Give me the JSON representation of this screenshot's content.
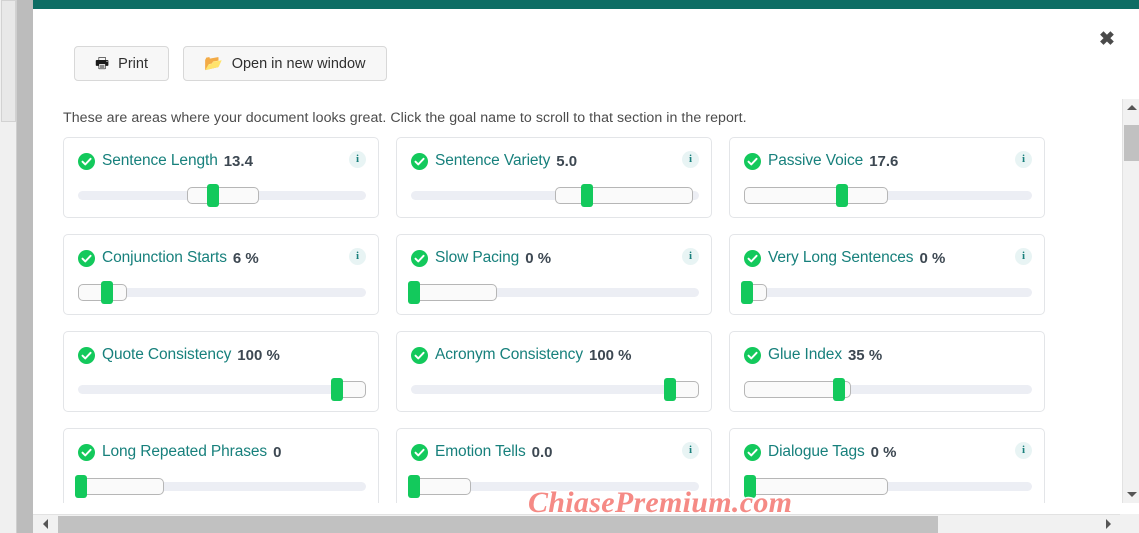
{
  "window": {
    "close_label": "✖",
    "accent_color": "#0e6d64"
  },
  "toolbar": {
    "print_label": "Print",
    "print_icon": "printer-icon",
    "open_label": "Open in new window",
    "open_icon": "folder-open-icon"
  },
  "description": "These are areas where your document looks great. Click the goal name to scroll to that section in the report.",
  "watermark": "ChiasePremium.com",
  "cards": [
    {
      "name": "Sentence Length",
      "value": "13.4",
      "has_info": true,
      "range_left_pct": 38,
      "range_width_pct": 25,
      "thumb_pct": 47
    },
    {
      "name": "Sentence Variety",
      "value": "5.0",
      "has_info": true,
      "range_left_pct": 50,
      "range_width_pct": 48,
      "thumb_pct": 61
    },
    {
      "name": "Passive Voice",
      "value": "17.6",
      "has_info": true,
      "range_left_pct": 0,
      "range_width_pct": 50,
      "thumb_pct": 34
    },
    {
      "name": "Conjunction Starts",
      "value": "6 %",
      "has_info": true,
      "range_left_pct": 0,
      "range_width_pct": 17,
      "thumb_pct": 10
    },
    {
      "name": "Slow Pacing",
      "value": "0 %",
      "has_info": true,
      "range_left_pct": 0,
      "range_width_pct": 30,
      "thumb_pct": 1
    },
    {
      "name": "Very Long Sentences",
      "value": "0 %",
      "has_info": true,
      "range_left_pct": 0,
      "range_width_pct": 8,
      "thumb_pct": 1
    },
    {
      "name": "Quote Consistency",
      "value": "100 %",
      "has_info": false,
      "range_left_pct": 90,
      "range_width_pct": 10,
      "thumb_pct": 90
    },
    {
      "name": "Acronym Consistency",
      "value": "100 %",
      "has_info": false,
      "range_left_pct": 90,
      "range_width_pct": 10,
      "thumb_pct": 90
    },
    {
      "name": "Glue Index",
      "value": "35 %",
      "has_info": false,
      "range_left_pct": 0,
      "range_width_pct": 37,
      "thumb_pct": 33
    },
    {
      "name": "Long Repeated Phrases",
      "value": "0",
      "has_info": false,
      "range_left_pct": 0,
      "range_width_pct": 30,
      "thumb_pct": 1
    },
    {
      "name": "Emotion Tells",
      "value": "0.0",
      "has_info": true,
      "range_left_pct": 0,
      "range_width_pct": 21,
      "thumb_pct": 1
    },
    {
      "name": "Dialogue Tags",
      "value": "0 %",
      "has_info": true,
      "range_left_pct": 0,
      "range_width_pct": 50,
      "thumb_pct": 2
    }
  ],
  "info_icon_label": "i"
}
